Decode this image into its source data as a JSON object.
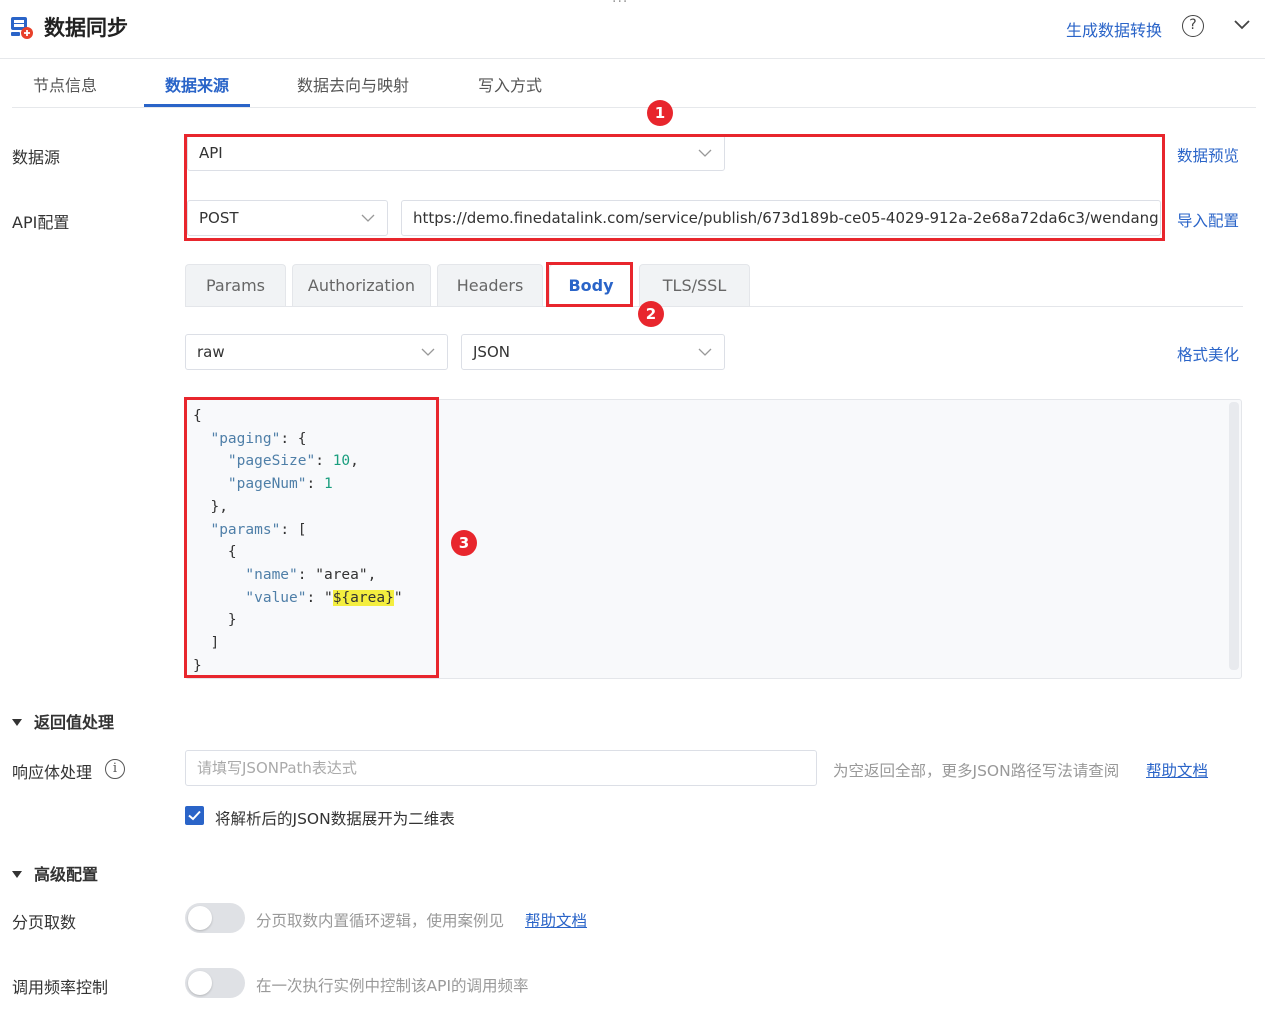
{
  "header": {
    "title": "数据同步",
    "generate_link": "生成数据转换"
  },
  "tabs": [
    {
      "label": "节点信息",
      "active": false
    },
    {
      "label": "数据来源",
      "active": true
    },
    {
      "label": "数据去向与映射",
      "active": false
    },
    {
      "label": "写入方式",
      "active": false
    }
  ],
  "datasource": {
    "label": "数据源",
    "value": "API",
    "preview_link": "数据预览"
  },
  "api_config": {
    "label": "API配置",
    "method": "POST",
    "url": "https://demo.finedatalink.com/service/publish/673d189b-ce05-4029-912a-2e68a72da6c3/wendang",
    "import_link": "导入配置"
  },
  "subtabs": [
    {
      "label": "Params",
      "active": false
    },
    {
      "label": "Authorization",
      "active": false
    },
    {
      "label": "Headers",
      "active": false
    },
    {
      "label": "Body",
      "active": true
    },
    {
      "label": "TLS/SSL",
      "active": false
    }
  ],
  "body": {
    "type": "raw",
    "format": "JSON",
    "beautify_link": "格式美化",
    "code_lines": [
      "{",
      "  \"paging\": {",
      "    \"pageSize\": 10,",
      "    \"pageNum\": 1",
      "  },",
      "  \"params\": [",
      "    {",
      "      \"name\": \"area\",",
      "      \"value\": \"${area}\"",
      "    }",
      "  ]",
      "}"
    ]
  },
  "badges": [
    "1",
    "2",
    "3"
  ],
  "return_section": {
    "title": "返回值处理",
    "response_label": "响应体处理",
    "response_placeholder": "请填写JSONPath表达式",
    "hint": "为空返回全部，更多JSON路径写法请查阅",
    "help_link": "帮助文档",
    "checkbox_label": "将解析后的JSON数据展开为二维表",
    "checkbox_checked": true
  },
  "advanced_section": {
    "title": "高级配置",
    "paging_label": "分页取数",
    "paging_hint": "分页取数内置循环逻辑，使用案例见",
    "paging_help_link": "帮助文档",
    "paging_enabled": false,
    "rate_label": "调用频率控制",
    "rate_hint": "在一次执行实例中控制该API的调用频率",
    "rate_enabled": false
  },
  "colors": {
    "accent": "#2a64c8",
    "highlight_red": "#e8262d"
  }
}
